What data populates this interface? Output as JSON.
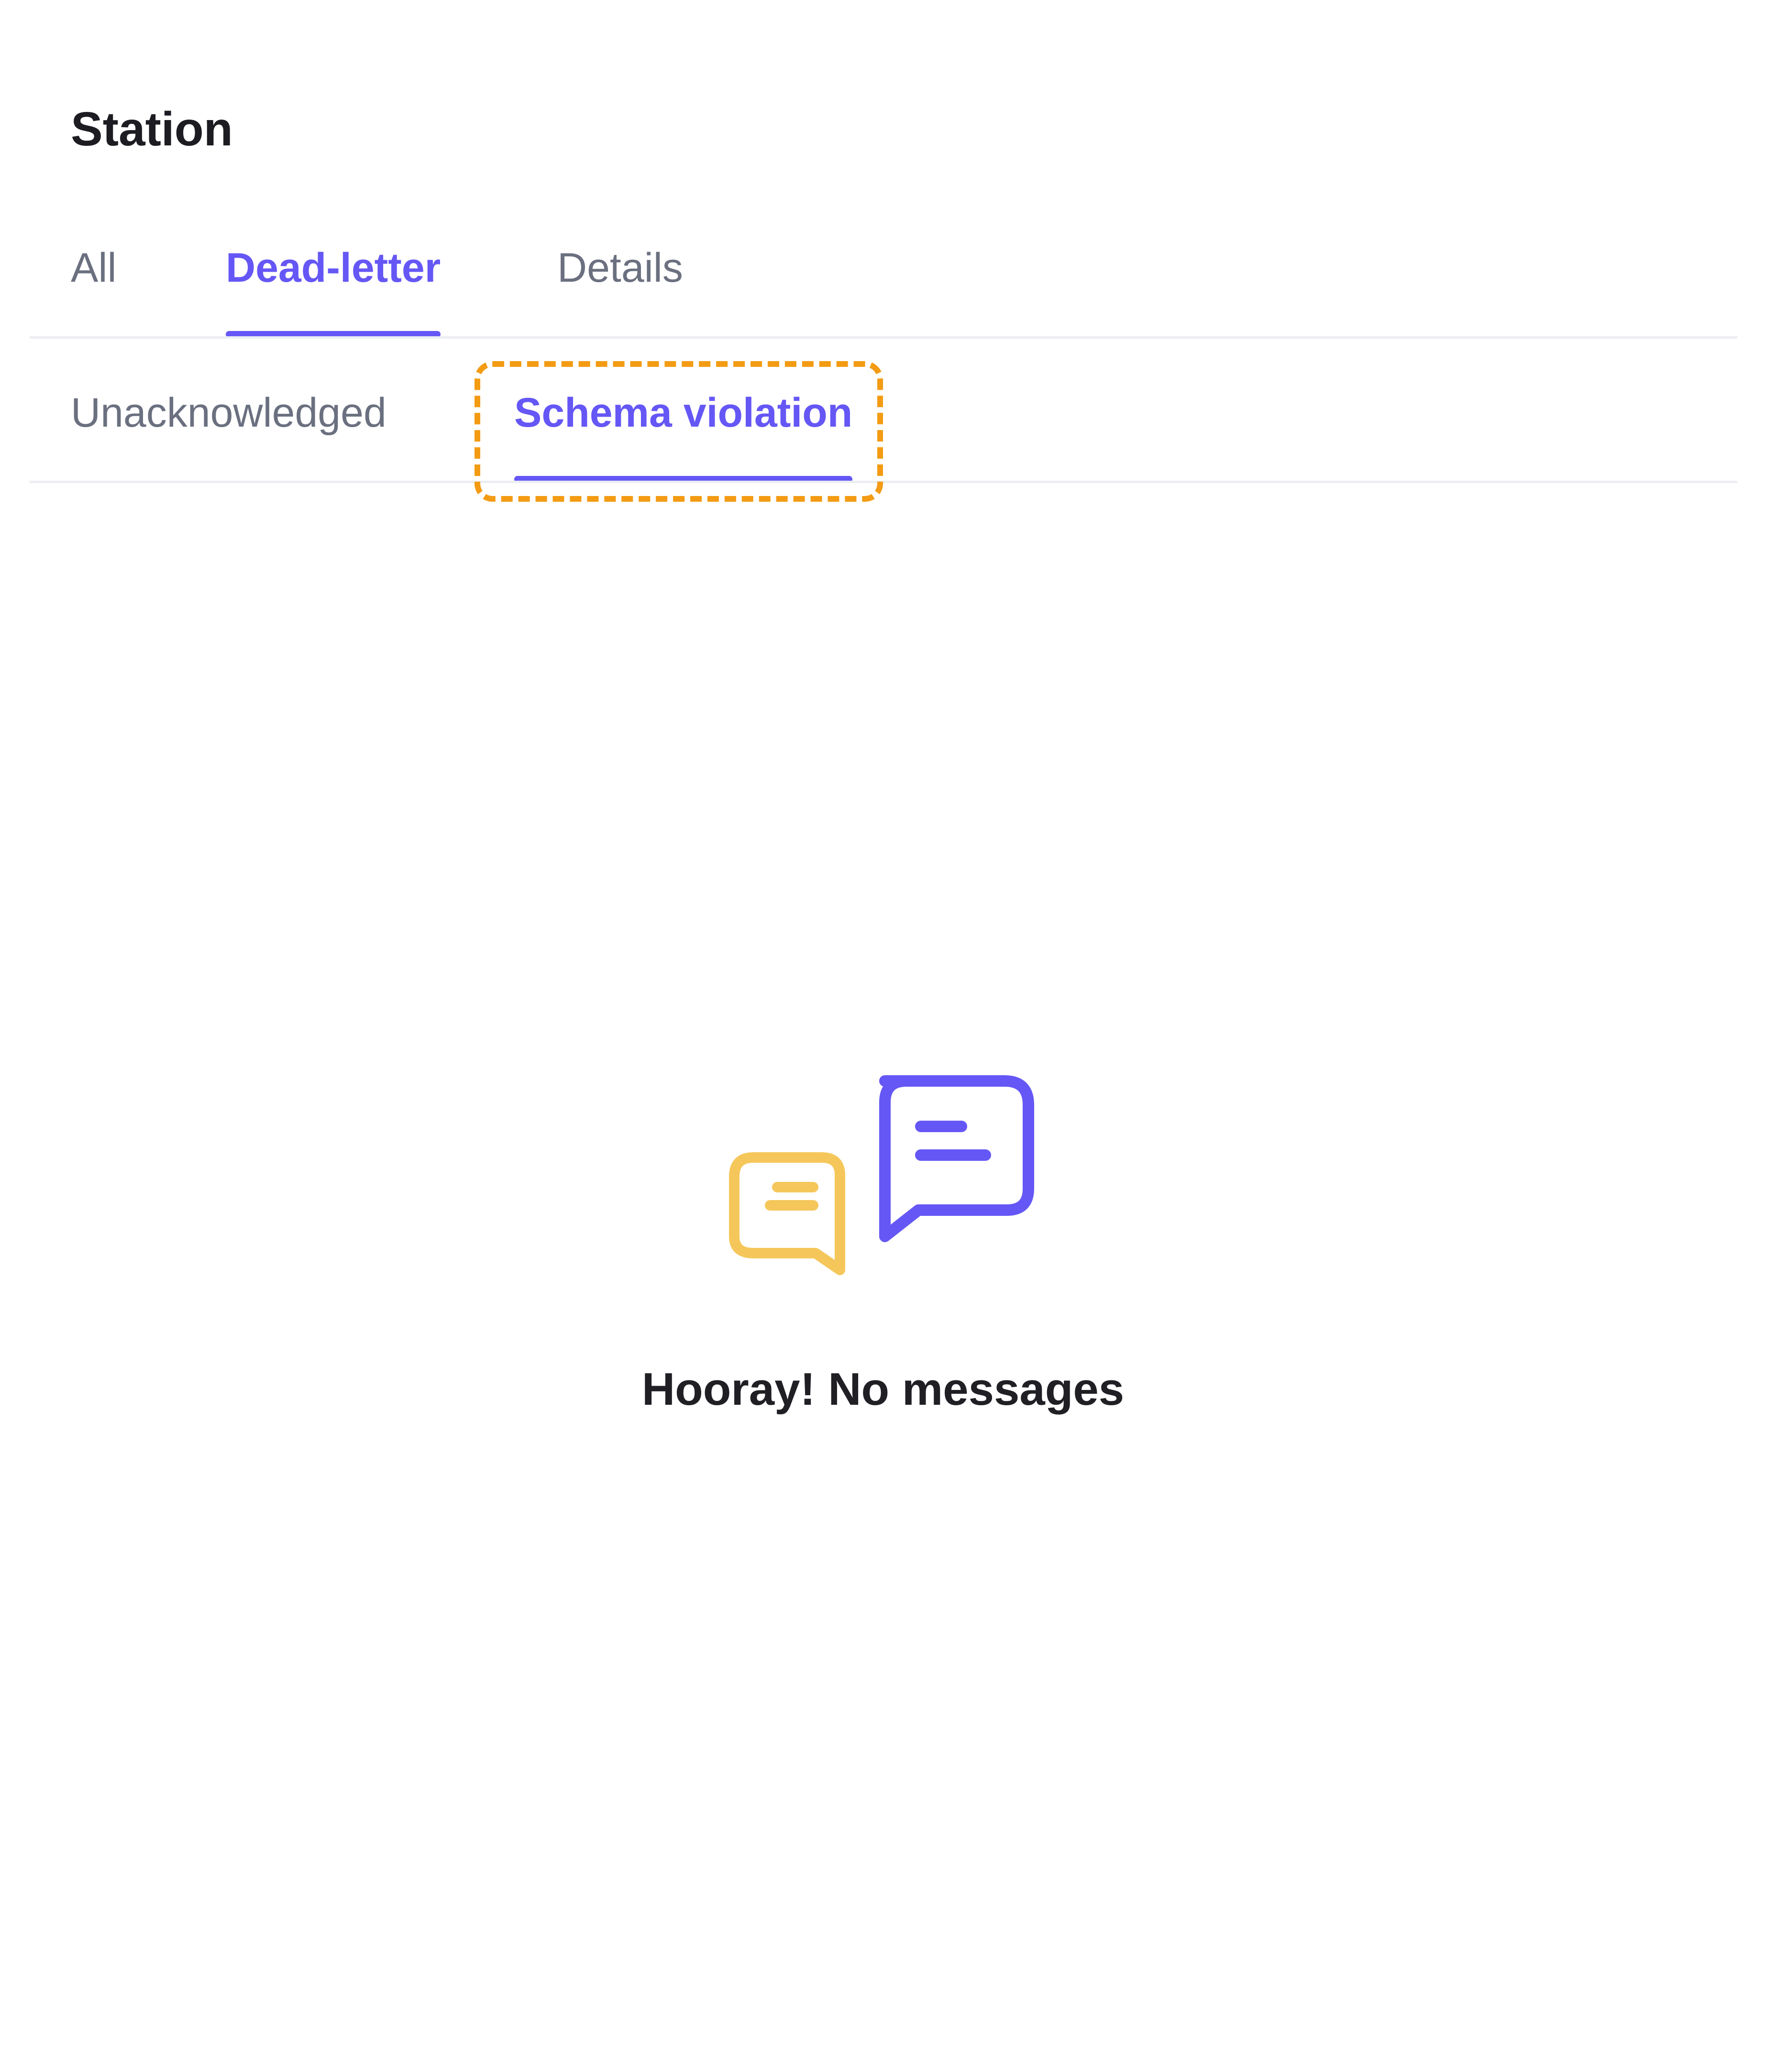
{
  "header": {
    "title": "Station"
  },
  "primary_tabs": [
    {
      "label": "All",
      "active": false
    },
    {
      "label": "Dead-letter",
      "active": true
    },
    {
      "label": "Details",
      "active": false
    }
  ],
  "secondary_tabs": [
    {
      "label": "Unacknowledged",
      "active": false
    },
    {
      "label": "Schema violation",
      "active": true
    }
  ],
  "empty_state": {
    "icon": "chat-bubbles-icon",
    "message": "Hooray! No messages"
  },
  "colors": {
    "accent": "#6557f5",
    "inactive_text": "#6b7080",
    "highlight_outline": "#f39b13",
    "bubble_yellow": "#f5c75a",
    "bubble_purple": "#6557f5"
  }
}
